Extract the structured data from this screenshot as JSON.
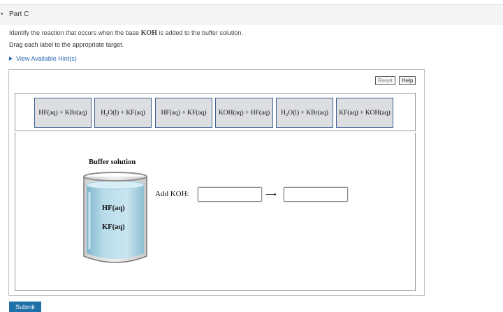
{
  "part": {
    "marker": "•",
    "title": "Part C"
  },
  "prompt": {
    "before": "Identify the reaction that occurs when the base ",
    "formula": "KOH",
    "after": " is added to the buffer solution."
  },
  "instruction": "Drag each label to the appropriate target.",
  "hint_link": "View Available Hint(s)",
  "toolbar": {
    "reset_label": "Reset",
    "help_label": "Help"
  },
  "labels": [
    "HF(aq) + KBr(aq)",
    "H₂O(l) + KF(aq)",
    "HF(aq) + KF(aq)",
    "KOH(aq) + HF(aq)",
    "H₂O(l) + KBr(aq)",
    "KF(aq) + KOH(aq)"
  ],
  "buffer": {
    "title": "Buffer solution",
    "components": [
      "HF(aq)",
      "KF(aq)"
    ]
  },
  "reaction": {
    "prompt": "Add KOH:",
    "arrow": "⟶"
  },
  "submit_label": "Submit",
  "colors": {
    "accent": "#1f6fa8",
    "tile_border": "#3f5f8f",
    "tile_fill": "#dcdee1",
    "liquid": "#b8dcea"
  }
}
